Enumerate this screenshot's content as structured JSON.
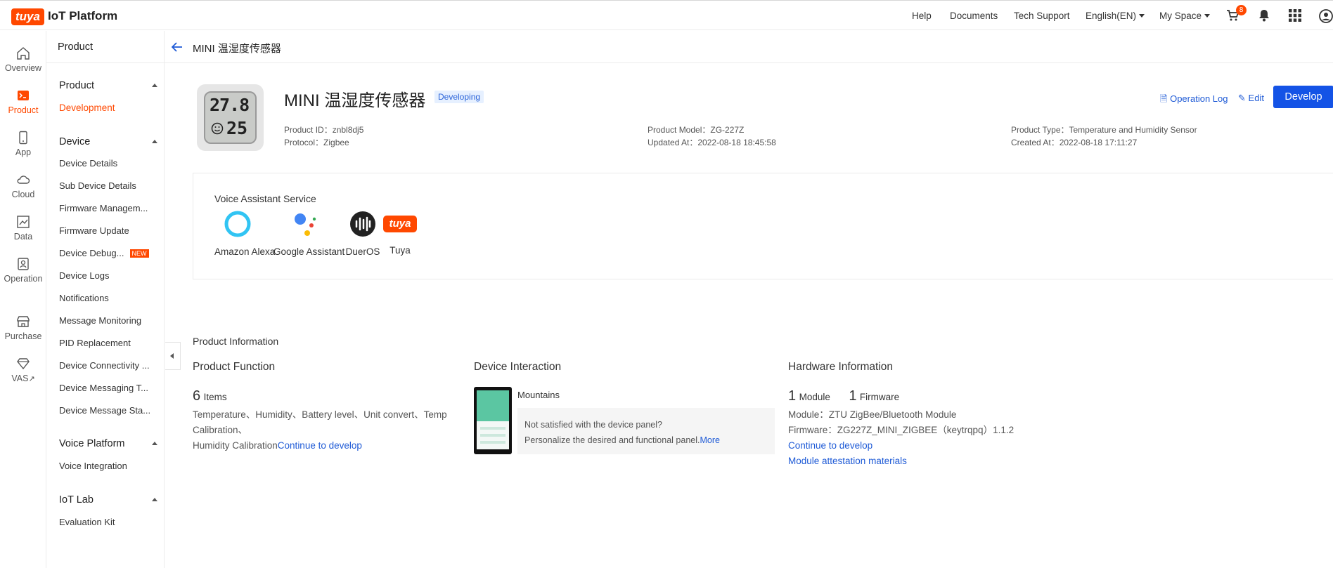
{
  "topbar": {
    "logo_mark": "tuya",
    "logo_text": "IoT Platform",
    "nav": [
      "Help",
      "Documents",
      "Tech Support",
      "English(EN)",
      "My Space"
    ],
    "cart_count": "8"
  },
  "rail": [
    {
      "label": "Overview",
      "icon": "home-icon"
    },
    {
      "label": "Product",
      "icon": "terminal-icon",
      "active": true
    },
    {
      "label": "App",
      "icon": "phone-icon"
    },
    {
      "label": "Cloud",
      "icon": "cloud-icon"
    },
    {
      "label": "Data",
      "icon": "chart-icon"
    },
    {
      "label": "Operation",
      "icon": "badge-icon"
    },
    {
      "label": "Purchase",
      "icon": "store-icon"
    },
    {
      "label": "VAS",
      "icon": "diamond-icon"
    }
  ],
  "subnav": {
    "header": "Product",
    "sections": [
      {
        "title": "Product",
        "items": [
          "Development"
        ]
      },
      {
        "title": "Device",
        "items": [
          "Device Details",
          "Sub Device Details",
          "Firmware Managem...",
          "Firmware Update",
          "Device Debug...",
          "Device Logs",
          "Notifications",
          "Message Monitoring",
          "PID Replacement",
          "Device Connectivity ...",
          "Device Messaging T...",
          "Device Message Sta..."
        ]
      },
      {
        "title": "Voice Platform",
        "items": [
          "Voice Integration"
        ]
      },
      {
        "title": "IoT Lab",
        "items": [
          "Evaluation Kit"
        ]
      }
    ],
    "new_tag": "NEW"
  },
  "breadcrumb": {
    "title": "MINI 温湿度传感器"
  },
  "product": {
    "name": "MINI 温湿度传感器",
    "status": "Developing",
    "thumb_line1": "27.8",
    "thumb_line2": "25",
    "product_id": "Product ID：znbl8dj5",
    "protocol": "Protocol：Zigbee",
    "model": "Product Model：ZG-227Z",
    "updated": "Updated At：2022-08-18 18:45:58",
    "type": "Product Type：Temperature and Humidity Sensor",
    "created": "Created At：2022-08-18 17:11:27",
    "operation_log": "Operation Log",
    "edit": "Edit",
    "develop": "Develop"
  },
  "voice": {
    "title": "Voice Assistant Service",
    "services": [
      "Amazon Alexa",
      "Google Assistant",
      "DuerOS",
      "Tuya"
    ]
  },
  "info": {
    "section_title": "Product Information",
    "function": {
      "title": "Product Function",
      "count": "6",
      "unit": "Items",
      "list": "Temperature、Humidity、Battery level、Unit convert、Temp Calibration、",
      "list2": "Humidity Calibration",
      "link": "Continue to develop"
    },
    "interaction": {
      "title": "Device Interaction",
      "panel_name": "Mountains",
      "prompt": "Not satisfied with the device panel?",
      "prompt2": "Personalize the desired and functional panel.",
      "more": "More"
    },
    "hardware": {
      "title": "Hardware Information",
      "module_count": "1",
      "module_label": "Module",
      "firmware_count": "1",
      "firmware_label": "Firmware",
      "module": "Module：ZTU ZigBee/Bluetooth Module",
      "firmware": "Firmware：ZG227Z_MINI_ZIGBEE（keytrqpq）1.1.2",
      "link1": "Continue to develop",
      "link2": "Module attestation materials"
    }
  },
  "colors": {
    "accent": "#ff4800",
    "primary": "#1453e6",
    "link": "#1e5ad6"
  }
}
